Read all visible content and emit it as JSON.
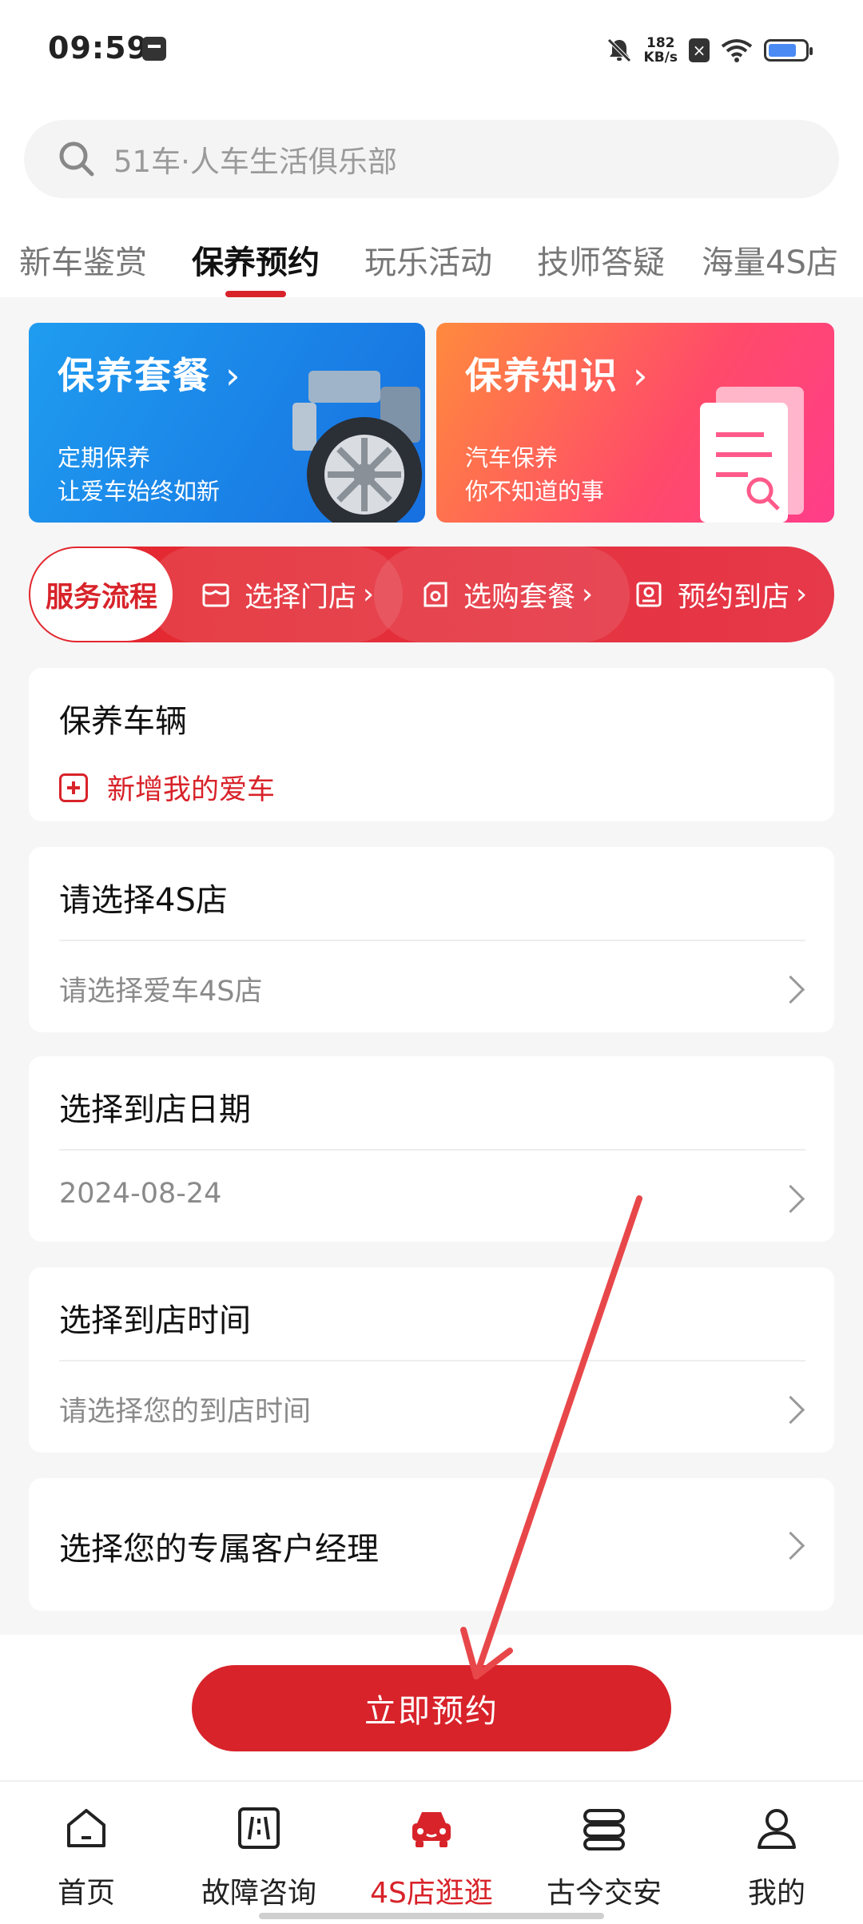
{
  "status_bar": {
    "time": "09:59",
    "speed_value": "182",
    "speed_unit": "KB/s"
  },
  "search": {
    "placeholder": "51车·人车生活俱乐部"
  },
  "tabs": [
    {
      "label": "新车鉴赏"
    },
    {
      "label": "保养预约",
      "active": true
    },
    {
      "label": "玩乐活动"
    },
    {
      "label": "技师答疑"
    },
    {
      "label": "海量4S店"
    }
  ],
  "banners": {
    "package": {
      "title": "保养套餐",
      "line1": "定期保养",
      "line2": "让爱车始终如新"
    },
    "knowledge": {
      "title": "保养知识",
      "line1": "汽车保养",
      "line2": "你不知道的事"
    }
  },
  "service_flow": {
    "label": "服务流程",
    "steps": [
      "选择门店",
      "选购套餐",
      "预约到店"
    ]
  },
  "vehicle": {
    "title": "保养车辆",
    "add_label": "新增我的爱车"
  },
  "store": {
    "title": "请选择4S店",
    "value": "请选择爱车4S店"
  },
  "date": {
    "title": "选择到店日期",
    "value": "2024-08-24"
  },
  "time_slot": {
    "title": "选择到店时间",
    "value": "请选择您的到店时间"
  },
  "manager": {
    "title": "选择您的专属客户经理"
  },
  "book_button": "立即预约",
  "bottom_nav": [
    {
      "label": "首页",
      "icon": "home-icon"
    },
    {
      "label": "故障咨询",
      "icon": "road-icon"
    },
    {
      "label": "4S店逛逛",
      "icon": "car-icon",
      "active": true
    },
    {
      "label": "古今交安",
      "icon": "books-icon"
    },
    {
      "label": "我的",
      "icon": "person-icon"
    }
  ],
  "colors": {
    "accent": "#d8232a",
    "banner_blue": "#1f8ff0",
    "banner_pink": "#ff4a6a"
  }
}
